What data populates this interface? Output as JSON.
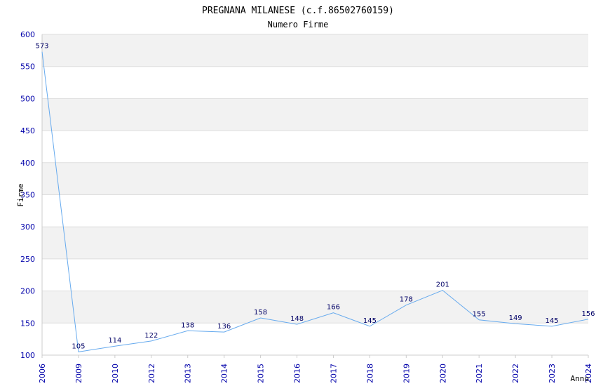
{
  "chart_data": {
    "type": "line",
    "title": "PREGNANA MILANESE (c.f.86502760159)",
    "subtitle": "Numero Firme",
    "xlabel": "Anno",
    "ylabel": "Firme",
    "ylim": [
      100,
      600
    ],
    "yticks": [
      "100",
      "150",
      "200",
      "250",
      "300",
      "350",
      "400",
      "450",
      "500",
      "550",
      "600"
    ],
    "x": [
      "2006",
      "2009",
      "2010",
      "2012",
      "2013",
      "2014",
      "2015",
      "2016",
      "2017",
      "2018",
      "2019",
      "2020",
      "2021",
      "2022",
      "2023",
      "2024"
    ],
    "values": [
      573,
      105,
      114,
      122,
      138,
      136,
      158,
      148,
      166,
      145,
      178,
      201,
      155,
      149,
      145,
      156
    ],
    "grid": true,
    "bands": "alternating light gray horizontal bands",
    "colors": {
      "line": "#66aaee",
      "band": "#f2f2f2",
      "grid": "#dddddd",
      "tick_text": "#0000aa",
      "label_text": "#000066"
    }
  }
}
